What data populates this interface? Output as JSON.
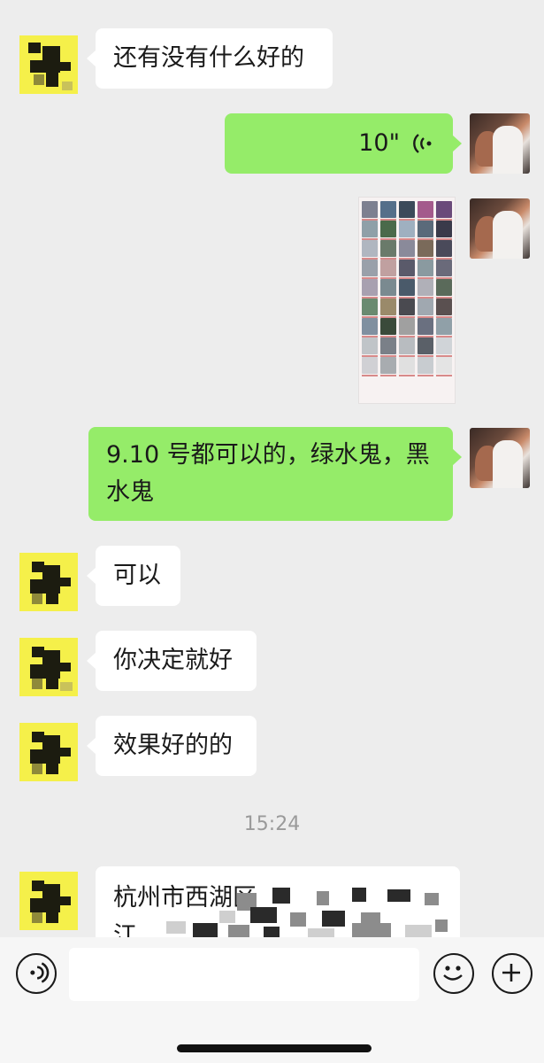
{
  "messages": [
    {
      "id": "m1",
      "side": "left",
      "type": "text",
      "text": "还有没有什么好的"
    },
    {
      "id": "m2",
      "side": "right",
      "type": "voice",
      "duration": "10\""
    },
    {
      "id": "m3",
      "side": "right",
      "type": "image",
      "description": "product catalogue image"
    },
    {
      "id": "m4",
      "side": "right",
      "type": "text",
      "line1": "9.10 号都可以的，绿水鬼，黑",
      "line2": "水鬼"
    },
    {
      "id": "m5",
      "side": "left",
      "type": "text",
      "text": "可以"
    },
    {
      "id": "m6",
      "side": "left",
      "type": "text",
      "text": "你决定就好"
    },
    {
      "id": "m7",
      "side": "left",
      "type": "text",
      "text": "效果好的的"
    },
    {
      "id": "m8",
      "side": "left",
      "type": "address",
      "line1": "杭州市西湖区",
      "line2": "江"
    }
  ],
  "timestamp": "15:24",
  "colors": {
    "sent_bubble": "#95ec69",
    "received_bubble": "#ffffff",
    "background": "#ededed"
  },
  "input_bar": {
    "voice_icon": "voice-mode-icon",
    "emoji_icon": "emoji-icon",
    "plus_icon": "plus-icon"
  }
}
